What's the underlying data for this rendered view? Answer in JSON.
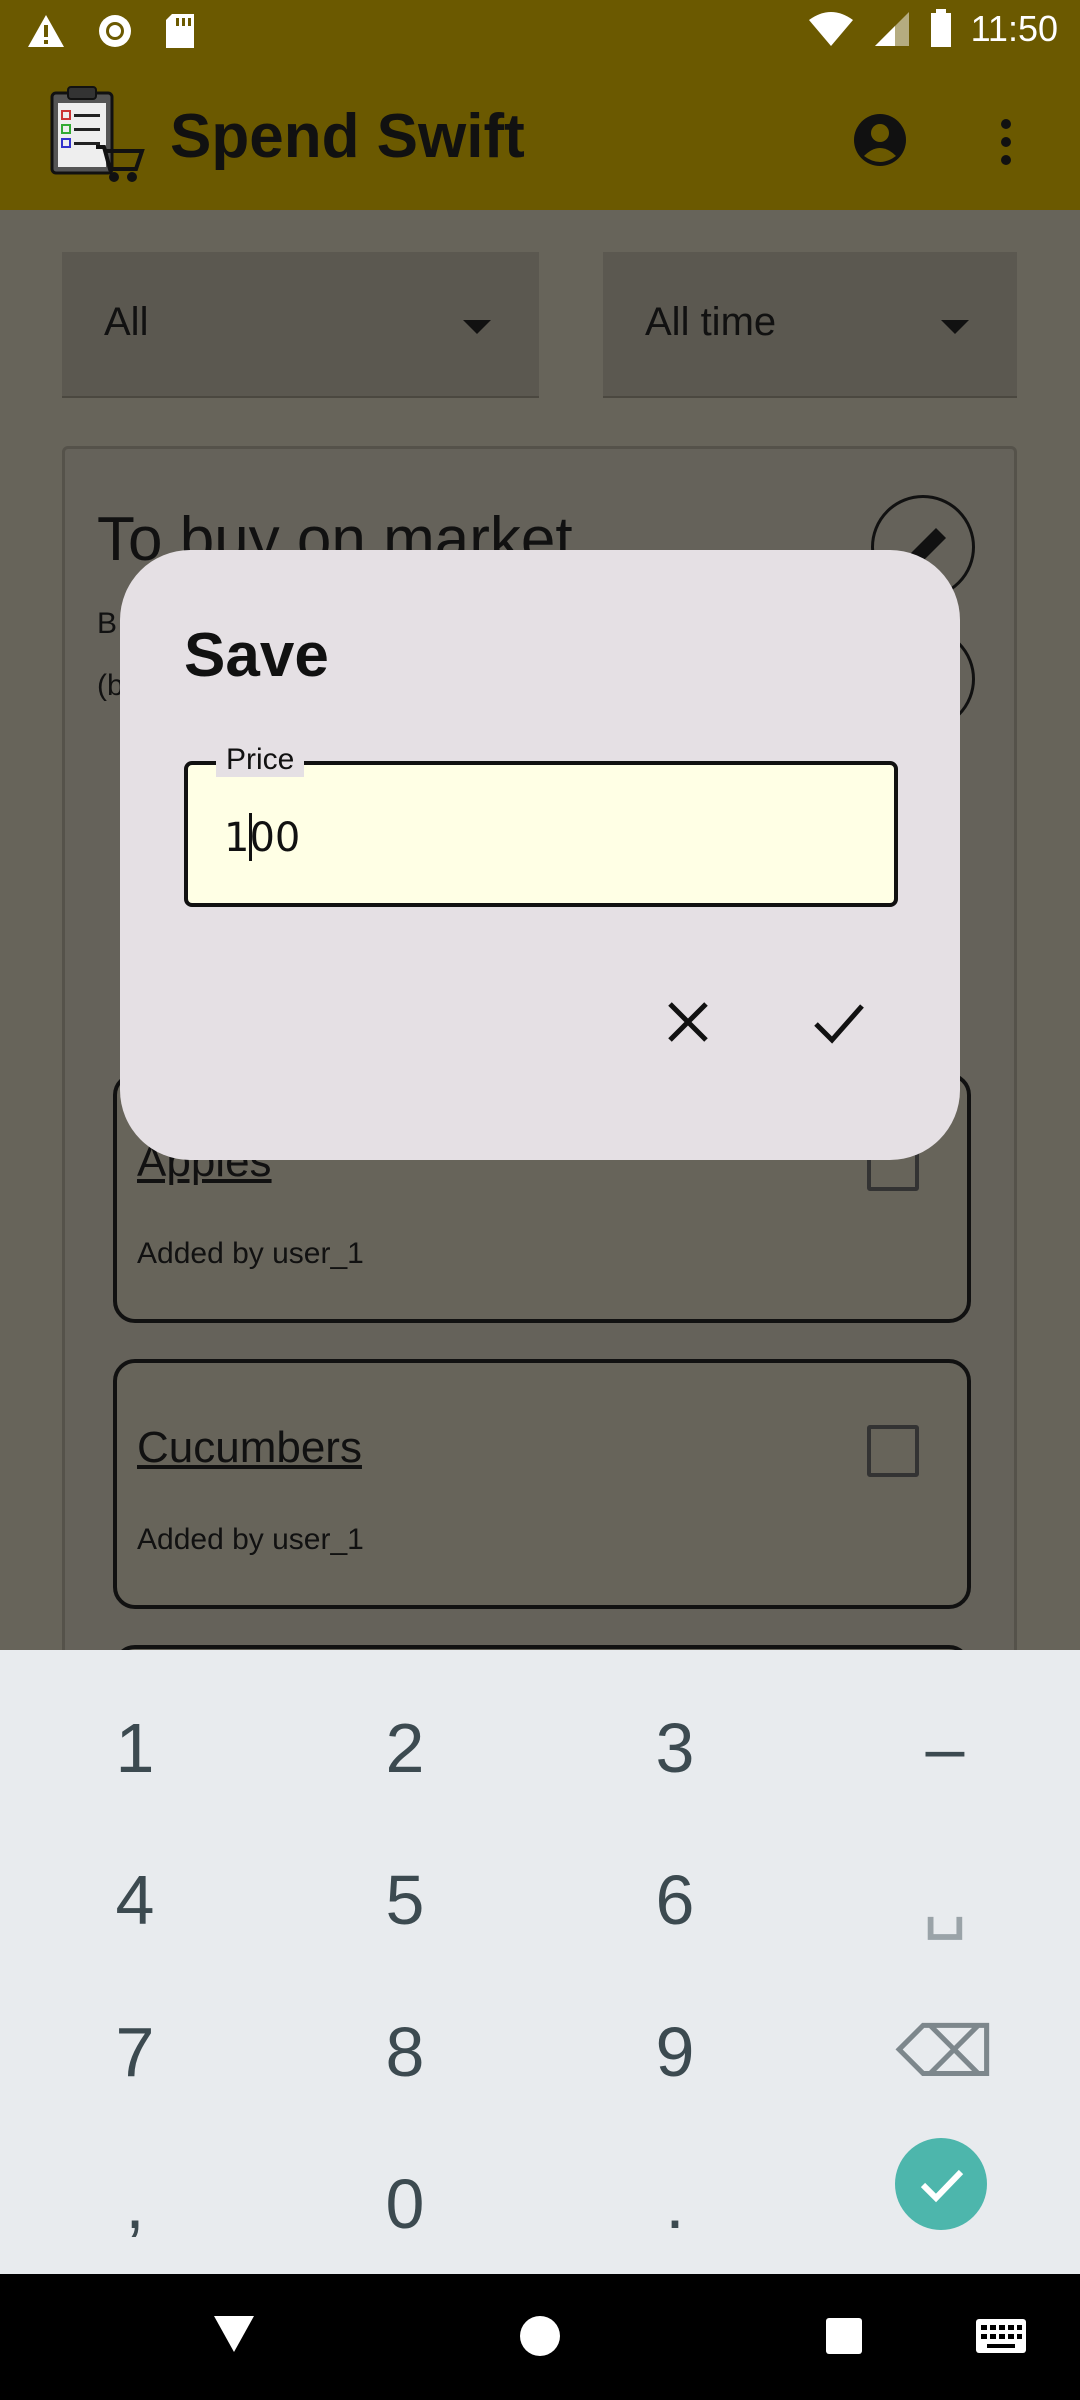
{
  "status_bar": {
    "time": "11:50"
  },
  "app_bar": {
    "title": "Spend Swift"
  },
  "filters": {
    "category": "All",
    "period": "All time"
  },
  "list_card": {
    "title": "To buy on market",
    "subtitle_line1": "B",
    "subtitle_line2": "(b",
    "items": [
      {
        "name": "Apples",
        "added_by": "Added by user_1"
      },
      {
        "name": "Cucumbers",
        "added_by": "Added by user_1"
      }
    ]
  },
  "dialog": {
    "title": "Save",
    "field_label": "Price",
    "field_value_before_cursor": "10",
    "field_value_after_cursor": "0"
  },
  "keyboard": {
    "keys": [
      "1",
      "2",
      "3",
      "–",
      "4",
      "5",
      "6",
      "␣",
      "7",
      "8",
      "9",
      "⌫",
      ",",
      "0",
      ".",
      "✓"
    ]
  }
}
